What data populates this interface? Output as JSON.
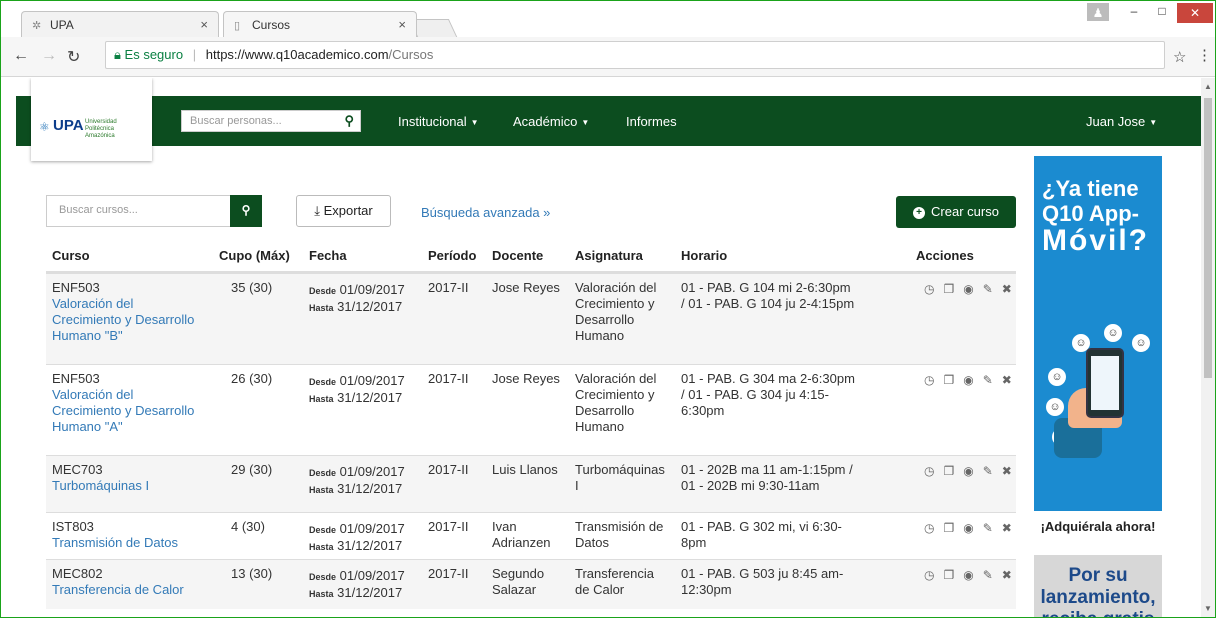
{
  "browser": {
    "tabs": [
      {
        "label": "UPA",
        "active": false
      },
      {
        "label": "Cursos",
        "active": true
      }
    ],
    "secure_label": "Es seguro",
    "url_host": "https://www.q10academico.com",
    "url_path": "/Cursos"
  },
  "appnav": {
    "logo_text": "UPA",
    "logo_sub": "Universidad Politécnica Amazónica",
    "search_placeholder": "Buscar personas...",
    "menu": [
      "Institucional",
      "Académico",
      "Informes"
    ],
    "user": "Juan Jose"
  },
  "toolbar": {
    "search_placeholder": "Buscar cursos...",
    "export_label": "Exportar",
    "advanced_label": "Búsqueda avanzada",
    "create_label": "Crear curso"
  },
  "table": {
    "headers": [
      "Curso",
      "Cupo (Máx)",
      "Fecha",
      "Período",
      "Docente",
      "Asignatura",
      "Horario",
      "Acciones"
    ],
    "date_labels": {
      "from": "Desde",
      "to": "Hasta"
    },
    "rows": [
      {
        "code": "ENF503",
        "name_lines": [
          "Valoración del",
          "Crecimiento y Desarrollo",
          "Humano \"B\""
        ],
        "cupo": "35 (30)",
        "from": "01/09/2017",
        "to": "31/12/2017",
        "period": "2017-II",
        "docente_lines": [
          "Jose Reyes"
        ],
        "asig_lines": [
          "Valoración del",
          "Crecimiento y",
          "Desarrollo",
          "Humano"
        ],
        "horario_lines": [
          "01 - PAB. G 104 mi 2-6:30pm",
          "/ 01 - PAB. G 104 ju 2-4:15pm"
        ]
      },
      {
        "code": "ENF503",
        "name_lines": [
          "Valoración del",
          "Crecimiento y Desarrollo",
          "Humano \"A\""
        ],
        "cupo": "26 (30)",
        "from": "01/09/2017",
        "to": "31/12/2017",
        "period": "2017-II",
        "docente_lines": [
          "Jose Reyes"
        ],
        "asig_lines": [
          "Valoración del",
          "Crecimiento y",
          "Desarrollo",
          "Humano"
        ],
        "horario_lines": [
          "01 - PAB. G 304 ma 2-6:30pm",
          "/ 01 - PAB. G 304 ju 4:15-",
          "6:30pm"
        ]
      },
      {
        "code": "MEC703",
        "name_lines": [
          "Turbomáquinas I"
        ],
        "cupo": "29 (30)",
        "from": "01/09/2017",
        "to": "31/12/2017",
        "period": "2017-II",
        "docente_lines": [
          "Luis Llanos"
        ],
        "asig_lines": [
          "Turbomáquinas",
          "I"
        ],
        "horario_lines": [
          "01 - 202B ma 11 am-1:15pm /",
          "01 - 202B mi 9:30-11am"
        ]
      },
      {
        "code": "IST803",
        "name_lines": [
          "Transmisión de Datos"
        ],
        "cupo": "4 (30)",
        "from": "01/09/2017",
        "to": "31/12/2017",
        "period": "2017-II",
        "docente_lines": [
          "Ivan",
          "Adrianzen"
        ],
        "asig_lines": [
          "Transmisión de",
          "Datos"
        ],
        "horario_lines": [
          "01 - PAB. G 302 mi, vi 6:30-",
          "8pm"
        ]
      },
      {
        "code": "MEC802",
        "name_lines": [
          "Transferencia de Calor"
        ],
        "cupo": "13 (30)",
        "from": "01/09/2017",
        "to": "31/12/2017",
        "period": "2017-II",
        "docente_lines": [
          "Segundo",
          "Salazar"
        ],
        "asig_lines": [
          "Transferencia",
          "de Calor"
        ],
        "horario_lines": [
          "01 - PAB. G 503 ju 8:45 am-",
          "12:30pm"
        ]
      }
    ],
    "action_icons": [
      "clock-icon",
      "copy-icon",
      "eye-icon",
      "pencil-icon",
      "delete-icon"
    ]
  },
  "ads": {
    "top_lines": [
      "¿Ya tiene",
      "Q10 App-",
      "Móvil?"
    ],
    "cta": "¡Adquiérala ahora!",
    "bottom_lines": [
      "Por su",
      "lanzamiento,",
      "reciba gratis"
    ]
  },
  "colors": {
    "brand_green": "#0c4d1f",
    "link_blue": "#337ab7",
    "ad_blue": "#1b8bd0"
  }
}
